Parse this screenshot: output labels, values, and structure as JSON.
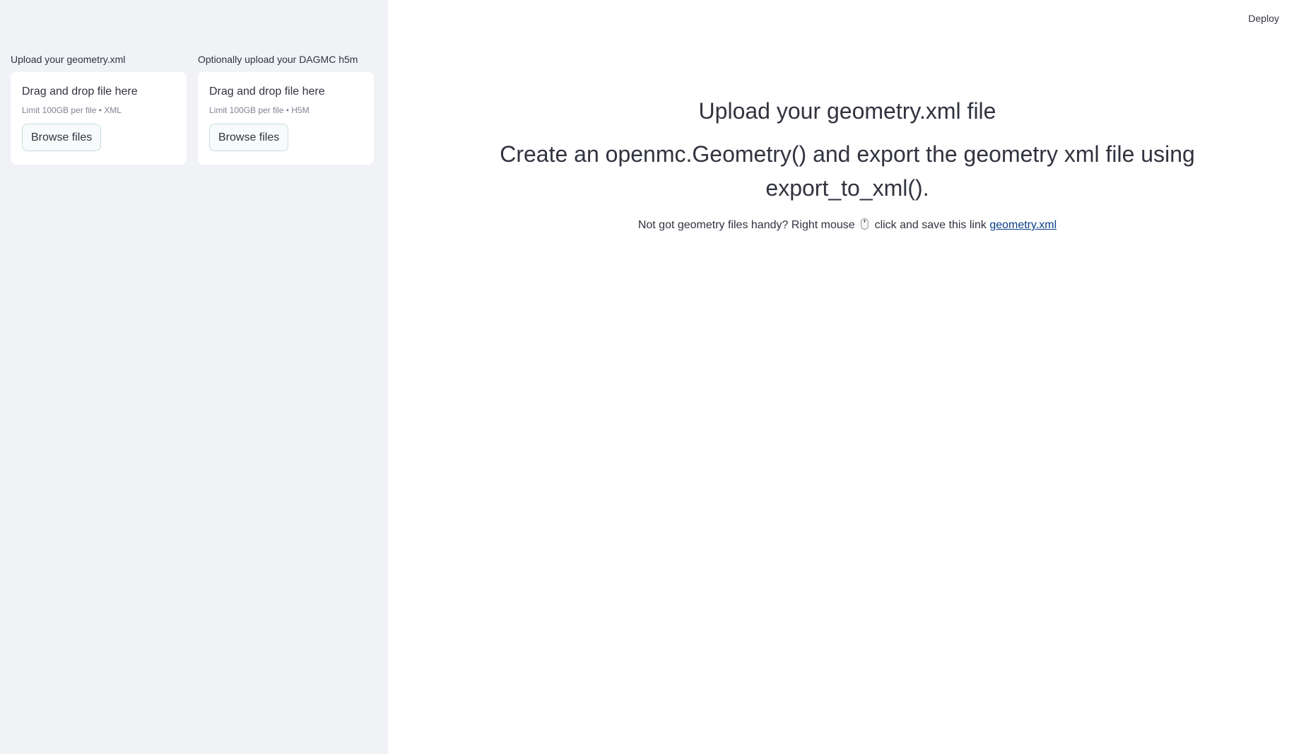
{
  "sidebar": {
    "uploaders": [
      {
        "label": "Upload your geometry.xml",
        "drop_text": "Drag and drop file here",
        "limit_text": "Limit 100GB per file • XML",
        "button_label": "Browse files"
      },
      {
        "label": "Optionally upload your DAGMC h5m",
        "drop_text": "Drag and drop file here",
        "limit_text": "Limit 100GB per file • H5M",
        "button_label": "Browse files"
      }
    ]
  },
  "header": {
    "deploy_label": "Deploy"
  },
  "main": {
    "title": "Upload your geometry.xml file",
    "subtitle": "Create an openmc.Geometry() and export the geometry xml file using export_to_xml().",
    "helper_prefix": "Not got geometry files handy? Right mouse",
    "helper_middle": "click and save this link",
    "link_text": "geometry.xml"
  },
  "icons": {
    "mouse": "computer-mouse-icon"
  }
}
